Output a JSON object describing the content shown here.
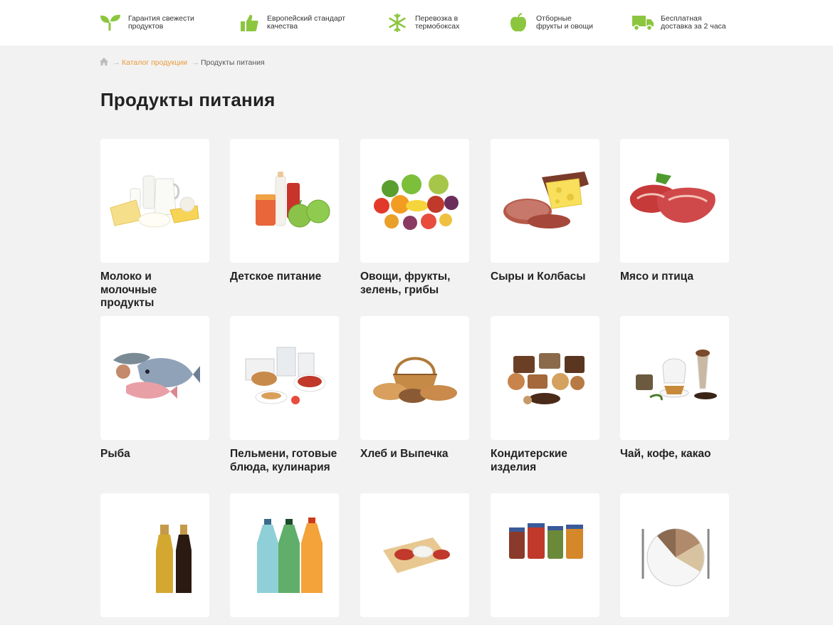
{
  "features": [
    {
      "icon": "sprout-icon",
      "text": "Гарантия свежести\nпродуктов"
    },
    {
      "icon": "thumbs-up-icon",
      "text": "Европейский стандарт\nкачества"
    },
    {
      "icon": "snowflake-icon",
      "text": "Перевозка в\nтермобоксах"
    },
    {
      "icon": "apple-icon",
      "text": "Отборные\nфрукты и овощи"
    },
    {
      "icon": "delivery-truck-icon",
      "text": "Бесплатная\nдоставка за 2 часа"
    }
  ],
  "breadcrumb": {
    "home_icon": "home-icon",
    "items": [
      "Каталог продукции",
      "Продукты питания"
    ]
  },
  "page_title": "Продукты питания",
  "categories": [
    {
      "title": "Молоко и молочные продукты",
      "image": "dairy-products-image"
    },
    {
      "title": "Детское питание",
      "image": "baby-food-image"
    },
    {
      "title": "Овощи, фрукты, зелень, грибы",
      "image": "vegetables-fruits-image"
    },
    {
      "title": "Сыры и Колбасы",
      "image": "cheese-sausage-image"
    },
    {
      "title": "Мясо и птица",
      "image": "meat-poultry-image"
    },
    {
      "title": "Рыба",
      "image": "fish-image"
    },
    {
      "title": "Пельмени, готовые блюда, кулинария",
      "image": "ready-meals-image"
    },
    {
      "title": "Хлеб и Выпечка",
      "image": "bread-basket-image"
    },
    {
      "title": "Кондитерские изделия",
      "image": "confectionery-image"
    },
    {
      "title": "Чай, кофе, какао",
      "image": "tea-coffee-image"
    },
    {
      "title": "",
      "image": "oil-vinegar-image"
    },
    {
      "title": "",
      "image": "drinks-bottles-image"
    },
    {
      "title": "",
      "image": "sauces-image"
    },
    {
      "title": "",
      "image": "preserves-jars-image"
    },
    {
      "title": "",
      "image": "plate-cutlery-image"
    }
  ],
  "colors": {
    "accent": "#8cc63f",
    "link": "#e89b3a",
    "background": "#f2f2f2"
  }
}
